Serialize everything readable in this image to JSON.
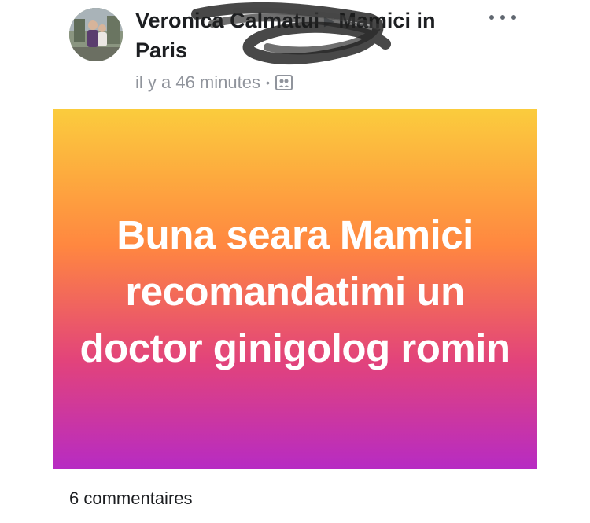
{
  "post": {
    "author": "Veronica Calmatui",
    "group": "Mamici in Paris",
    "timestamp": "il y a 46 minutes",
    "separator": "•",
    "privacy_icon": "group-photo-icon",
    "more_icon": "more-options-icon",
    "status_text": "Buna seara Mamici recomandatimi un doctor ginigolog romin",
    "status_gradient": [
      "#fbcc3d",
      "#ff8740",
      "#e2437b",
      "#b72bc3"
    ],
    "comments_count": "6 commentaires"
  }
}
